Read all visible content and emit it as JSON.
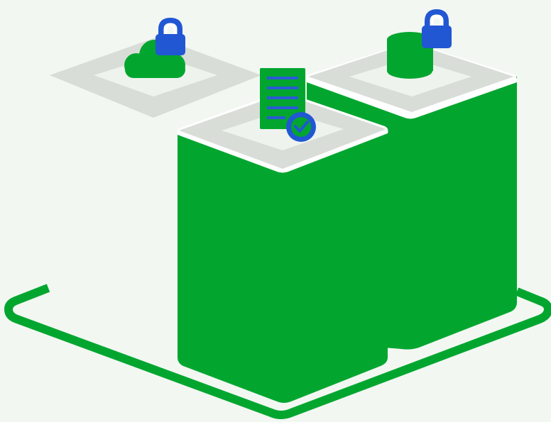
{
  "colors": {
    "background": "#f2f7f2",
    "brand_green": "#02a62f",
    "tile_gray": "#d9ddd8",
    "tile_inner": "#eef3ee",
    "lock_blue": "#2157d3",
    "doc_line_blue": "#2b59d6",
    "white": "#ffffff"
  },
  "icons": {
    "cloud": "cloud-icon",
    "cloud_lock": "padlock-icon",
    "database": "database-icon",
    "database_lock": "padlock-icon",
    "document": "document-icon",
    "check_badge": "checkmark-badge-icon"
  }
}
